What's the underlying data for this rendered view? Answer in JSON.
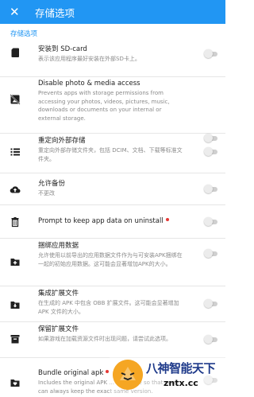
{
  "appbar": {
    "title": "存储选项",
    "close_icon": "close-icon",
    "color": "#2196f3"
  },
  "section": {
    "header": "存储选项"
  },
  "settings": [
    {
      "icon": "sd-card-icon",
      "title": "安装到 SD-card",
      "summary": "表示该应用程序最好安装在外部SD卡上。",
      "enabled": false,
      "new_badge": false
    },
    {
      "icon": "image-not-supported-icon",
      "title": "Disable photo & media access",
      "summary": "Prevents apps with storage permissions from accessing your photos, videos, pictures, music, downloads or documents on your internal or external storage.",
      "enabled": false,
      "new_badge": false
    },
    {
      "icon": "list-icon",
      "title": "重定向外部存储",
      "summary": "重定向外部存储文件夹，包括 DCIM、文档、下载等标准文件夹。",
      "enabled": false,
      "new_badge": false
    },
    {
      "icon": "cloud-upload-icon",
      "title": "允许备份",
      "summary": "不更改",
      "enabled": false,
      "new_badge": false
    },
    {
      "icon": "trash-icon",
      "title": "Prompt to keep app data on uninstall",
      "summary": "",
      "enabled": false,
      "new_badge": true
    },
    {
      "icon": "folder-plus-icon",
      "title": "捆绑应用数据",
      "summary": "允许使用以前导出的应用数据文件作为与可安装APK捆绑在一起的初始应用数据。这可能会显著增加APK的大小。",
      "enabled": false,
      "new_badge": false
    },
    {
      "icon": "folder-download-icon",
      "title": "集成扩展文件",
      "summary": "在生成的 APK 中包含 OBB 扩展文件。这可能会显著增加 APK 文件的大小。",
      "enabled": false,
      "new_badge": false
    },
    {
      "icon": "archive-icon",
      "title": "保留扩展文件",
      "summary": "如果游戏在加载资源文件时出现问题，请尝试此选项。",
      "enabled": false,
      "new_badge": false
    },
    {
      "icon": "folder-heart-icon",
      "title": "Bundle original apk",
      "summary": "Includes the original APK ... the clone so that you can always keep the exact same version.",
      "enabled": false,
      "new_badge": true
    }
  ],
  "watermark": {
    "line1": "八神智能天下",
    "line2": "zntx.cc"
  },
  "colors": {
    "accent": "#2196f3",
    "badge": "#e53935",
    "switch_track": "#cfcfcf",
    "switch_thumb": "#ececec"
  }
}
